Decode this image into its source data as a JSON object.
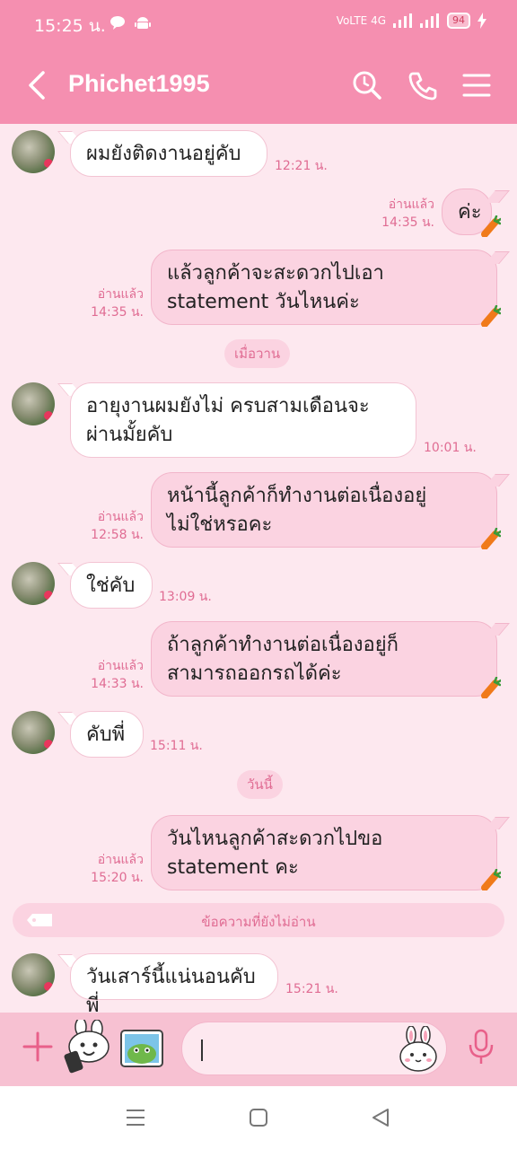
{
  "status_bar": {
    "time": "15:25 น.",
    "network": "VoLTE 4G",
    "battery": "94"
  },
  "header": {
    "title": "Phichet1995"
  },
  "messages": {
    "m1": {
      "text": "ผมยังติดงานอยู่คับ",
      "time": "12:21 น."
    },
    "m2": {
      "text": "ค่ะ",
      "read": "อ่านแล้ว",
      "time": "14:35 น."
    },
    "m3": {
      "line1": "แล้วลูกค้าจะสะดวกไปเอา",
      "line2": "statement วันไหนค่ะ",
      "read": "อ่านแล้ว",
      "time": "14:35 น."
    },
    "date1": "เมื่อวาน",
    "m4": {
      "line1": "อายุงานผมยังไม่ ครบสามเดือนจะ",
      "line2": "ผ่านมั้ยคับ",
      "time": "10:01 น."
    },
    "m5": {
      "line1": "หน้านี้ลูกค้าก็ทำงานต่อเนื่องอยู่",
      "line2": "ไม่ใช่หรอคะ",
      "read": "อ่านแล้ว",
      "time": "12:58 น."
    },
    "m6": {
      "text": "ใช่คับ",
      "time": "13:09 น."
    },
    "m7": {
      "line1": "ถ้าลูกค้าทำงานต่อเนื่องอยู่ก็",
      "line2": "สามารถออกรถได้ค่ะ",
      "read": "อ่านแล้ว",
      "time": "14:33 น."
    },
    "m8": {
      "text": "คับพี่",
      "time": "15:11 น."
    },
    "date2": "วันนี้",
    "m9": {
      "line1": "วันไหนลูกค้าสะดวกไปขอ",
      "line2": "statement คะ",
      "read": "อ่านแล้ว",
      "time": "15:20 น."
    },
    "unread": "ข้อความที่ยังไม่อ่าน",
    "m10": {
      "text": "วันเสาร์นี้แน่นอนคับพี่",
      "time": "15:21 น."
    }
  },
  "colors": {
    "header": "#f58fb0",
    "background": "#fde8ef",
    "outgoing_bubble": "#fbd3e1",
    "accent_text": "#e06c93"
  },
  "icons": [
    "back-icon",
    "search-icon",
    "phone-icon",
    "menu-icon",
    "plus-icon",
    "sticker-icon",
    "gallery-icon",
    "emoji-icon",
    "mic-icon",
    "carrot-icon"
  ]
}
